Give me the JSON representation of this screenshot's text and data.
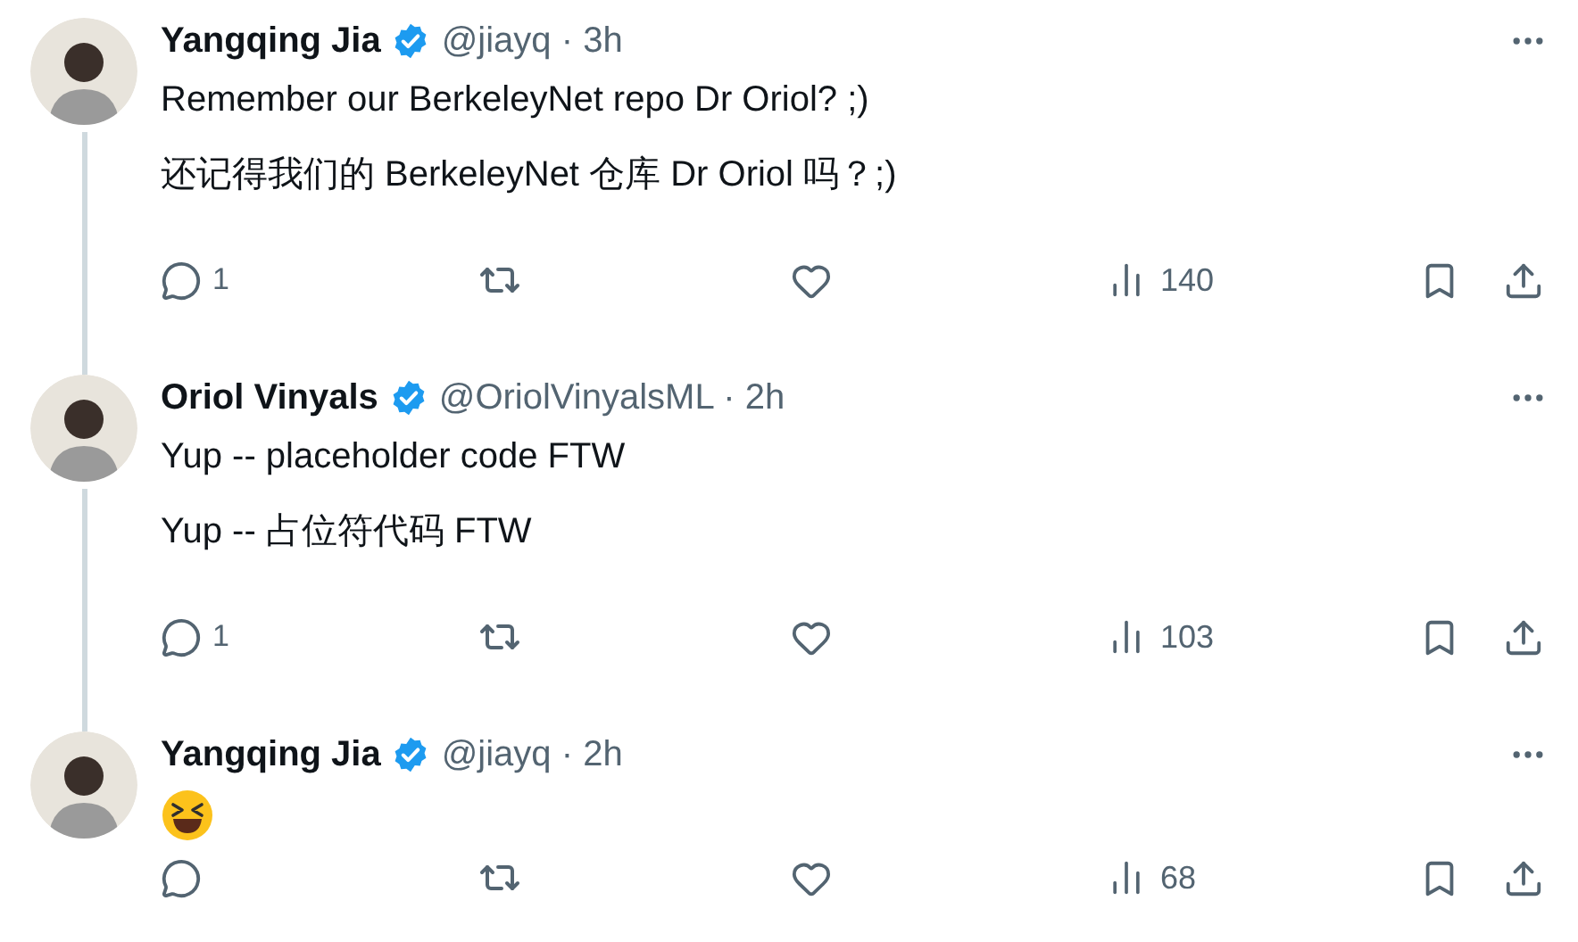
{
  "tweets": [
    {
      "author": "Yangqing Jia",
      "handle": "@jiayq · 3h",
      "verified": true,
      "thread_line": true,
      "paragraphs": [
        {
          "kind": "text",
          "text": "Remember our BerkeleyNet repo Dr Oriol? ;)"
        },
        {
          "kind": "text",
          "text": "还记得我们的 BerkeleyNet 仓库 Dr Oriol 吗？;)"
        }
      ],
      "replies": "1",
      "views": "140"
    },
    {
      "author": "Oriol Vinyals",
      "handle": "@OriolVinyalsML · 2h",
      "verified": true,
      "thread_line": true,
      "paragraphs": [
        {
          "kind": "text",
          "text": "Yup -- placeholder code FTW"
        },
        {
          "kind": "text",
          "text": "Yup -- 占位符代码 FTW"
        }
      ],
      "replies": "1",
      "views": "103"
    },
    {
      "author": "Yangqing Jia",
      "handle": "@jiayq · 2h",
      "verified": true,
      "thread_line": false,
      "paragraphs": [
        {
          "kind": "emoji"
        }
      ],
      "views": "68"
    }
  ]
}
